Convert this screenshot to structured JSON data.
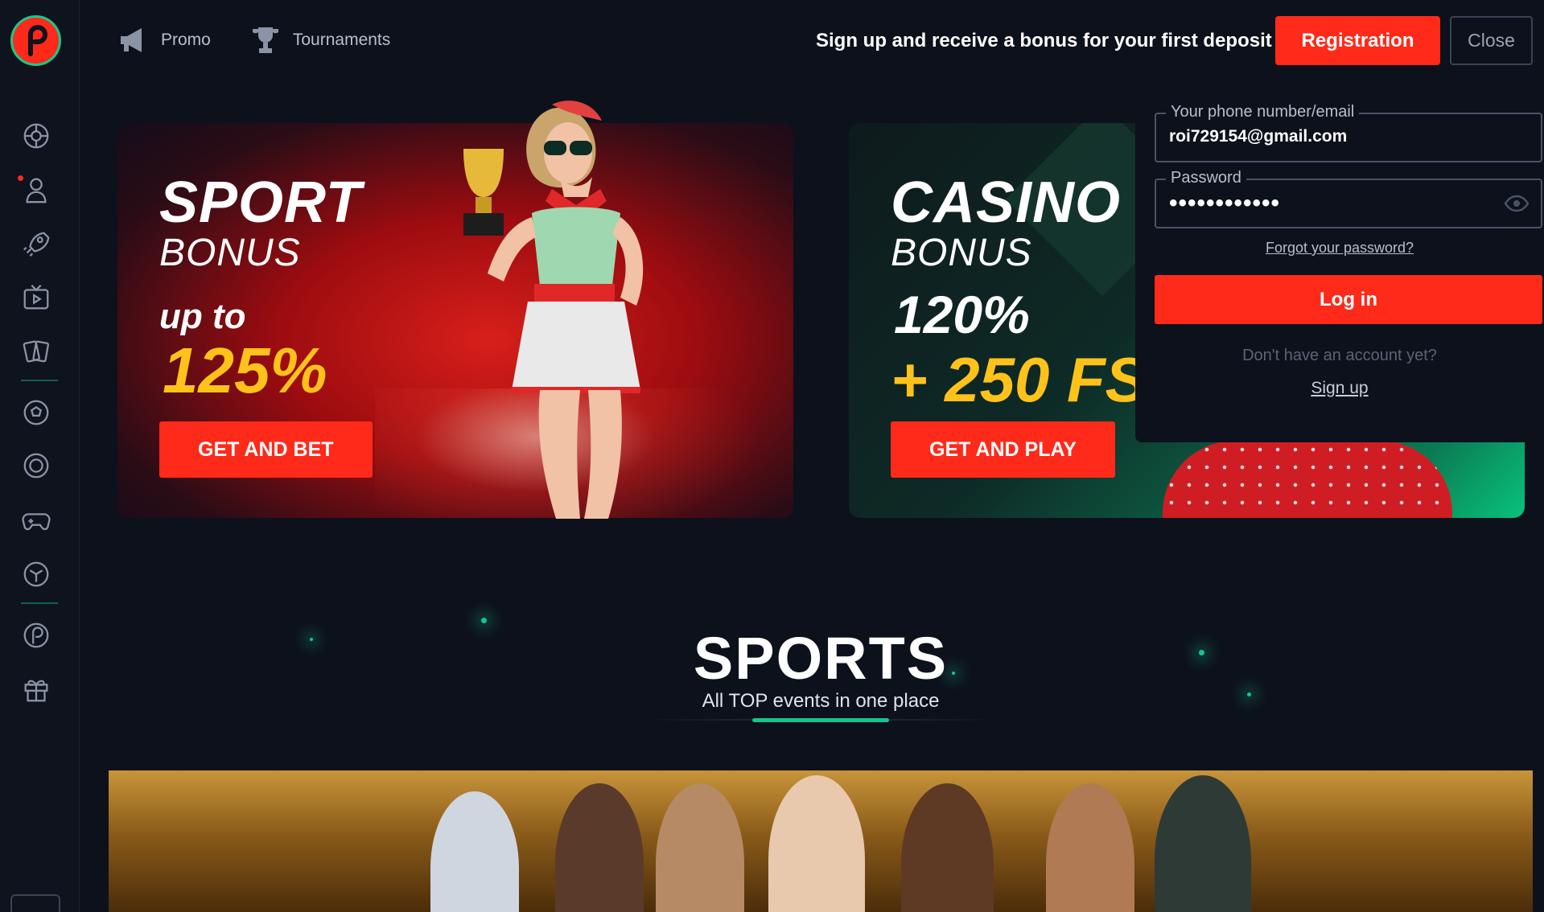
{
  "nav": {
    "promo": "Promo",
    "tournaments": "Tournaments"
  },
  "header": {
    "promo_text": "Sign up and receive a bonus for your first deposit",
    "registration": "Registration",
    "close": "Close"
  },
  "sport_banner": {
    "title": "SPORT",
    "subtitle": "BONUS",
    "up_to": "up to",
    "percent": "125%",
    "button": "GET AND BET"
  },
  "casino_banner": {
    "title": "CASINO",
    "subtitle": "BONUS",
    "percent": "120%",
    "free_spins": "+ 250 FS",
    "button": "GET AND PLAY"
  },
  "login": {
    "phone_label": "Your phone number/email",
    "phone_value": "roi729154@gmail.com",
    "password_label": "Password",
    "password_value": "••••••••••••",
    "forgot": "Forgot your password?",
    "login_button": "Log in",
    "no_account": "Don't have an account yet?",
    "signup": "Sign up"
  },
  "sports": {
    "title": "SPORTS",
    "subtitle": "All TOP events in one place"
  },
  "colors": {
    "accent_red": "#ff2a1a",
    "accent_green": "#17c58c",
    "bonus_yellow": "#ffc21a",
    "background": "#0d111b"
  },
  "sidebar_icons": [
    "sports-icon",
    "live-icon",
    "rocket-icon",
    "tv-icon",
    "cards-icon",
    "football-icon",
    "target-icon",
    "gamepad-icon",
    "esports-icon",
    "brand-icon",
    "gift-icon"
  ]
}
